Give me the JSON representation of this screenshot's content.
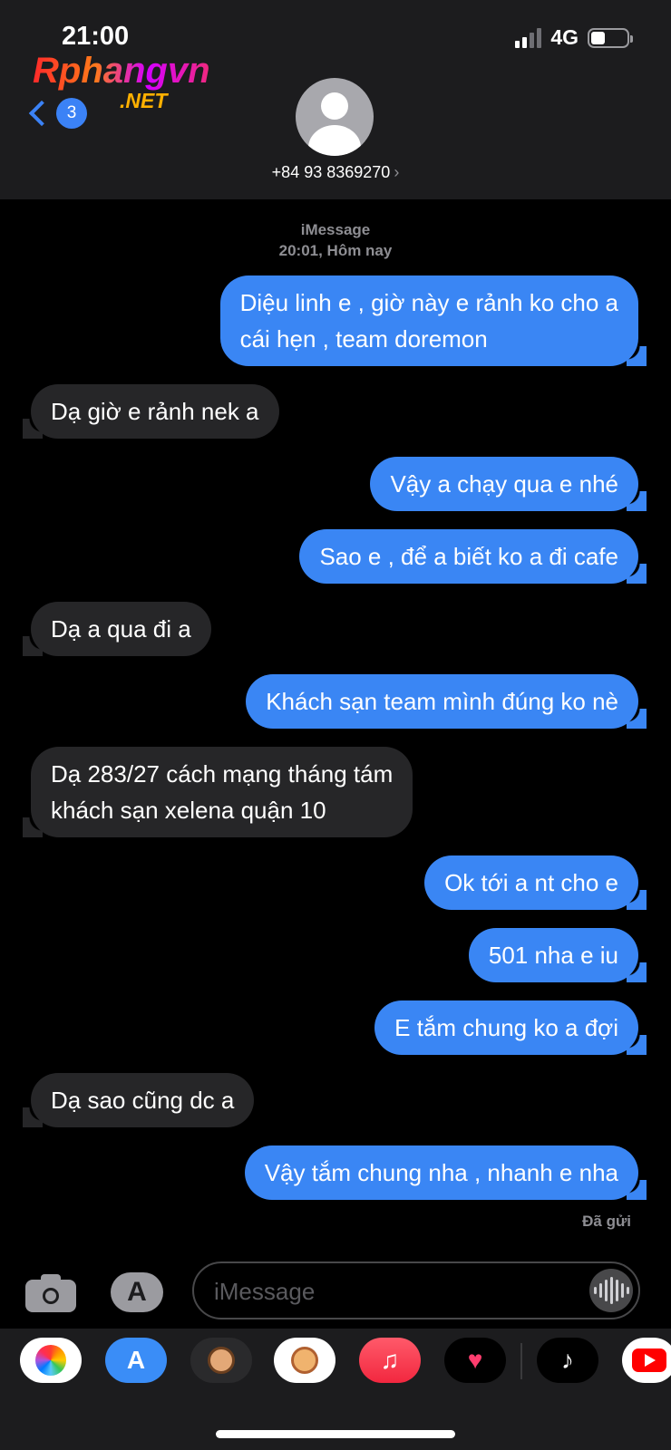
{
  "status_bar": {
    "time": "21:00",
    "network": "4G"
  },
  "watermark": {
    "main": "Rphangvn",
    "sub": ".NET"
  },
  "header": {
    "back_count": "3",
    "contact": "+84 93 8369270",
    "arrow": "›"
  },
  "conversation": {
    "service": "iMessage",
    "timestamp": "20:01, Hôm nay",
    "delivered": "Đã gửi",
    "messages": [
      {
        "dir": "out",
        "text": "Diệu linh e , giờ này e rảnh ko cho a\ncái hẹn , team doremon"
      },
      {
        "dir": "in",
        "text": "Dạ giờ e rảnh nek a"
      },
      {
        "dir": "out",
        "text": "Vậy a chạy qua e nhé"
      },
      {
        "dir": "out",
        "text": "Sao e , để a biết ko a đi cafe"
      },
      {
        "dir": "in",
        "text": "Dạ a qua đi a"
      },
      {
        "dir": "out",
        "text": "Khách sạn team mình đúng ko nè"
      },
      {
        "dir": "in",
        "text": "Dạ 283/27 cách mạng tháng tám\nkhách sạn xelena quận 10"
      },
      {
        "dir": "out",
        "text": "Ok tới a nt cho e"
      },
      {
        "dir": "out",
        "text": "501 nha e iu"
      },
      {
        "dir": "out",
        "text": "E tắm chung ko a đợi"
      },
      {
        "dir": "in",
        "text": "Dạ sao cũng dc a"
      },
      {
        "dir": "out",
        "text": "Vậy tắm chung nha , nhanh e nha"
      }
    ]
  },
  "composer": {
    "placeholder": "iMessage"
  },
  "app_drawer": {
    "apps": [
      "photos-icon",
      "app-store-icon",
      "memoji-icon",
      "memoji-stickers-icon",
      "music-icon",
      "digital-touch-icon",
      "tiktok-icon",
      "youtube-icon"
    ]
  },
  "colors": {
    "outgoing": "#3a86f4",
    "incoming": "#262628",
    "header": "#1c1c1e"
  }
}
